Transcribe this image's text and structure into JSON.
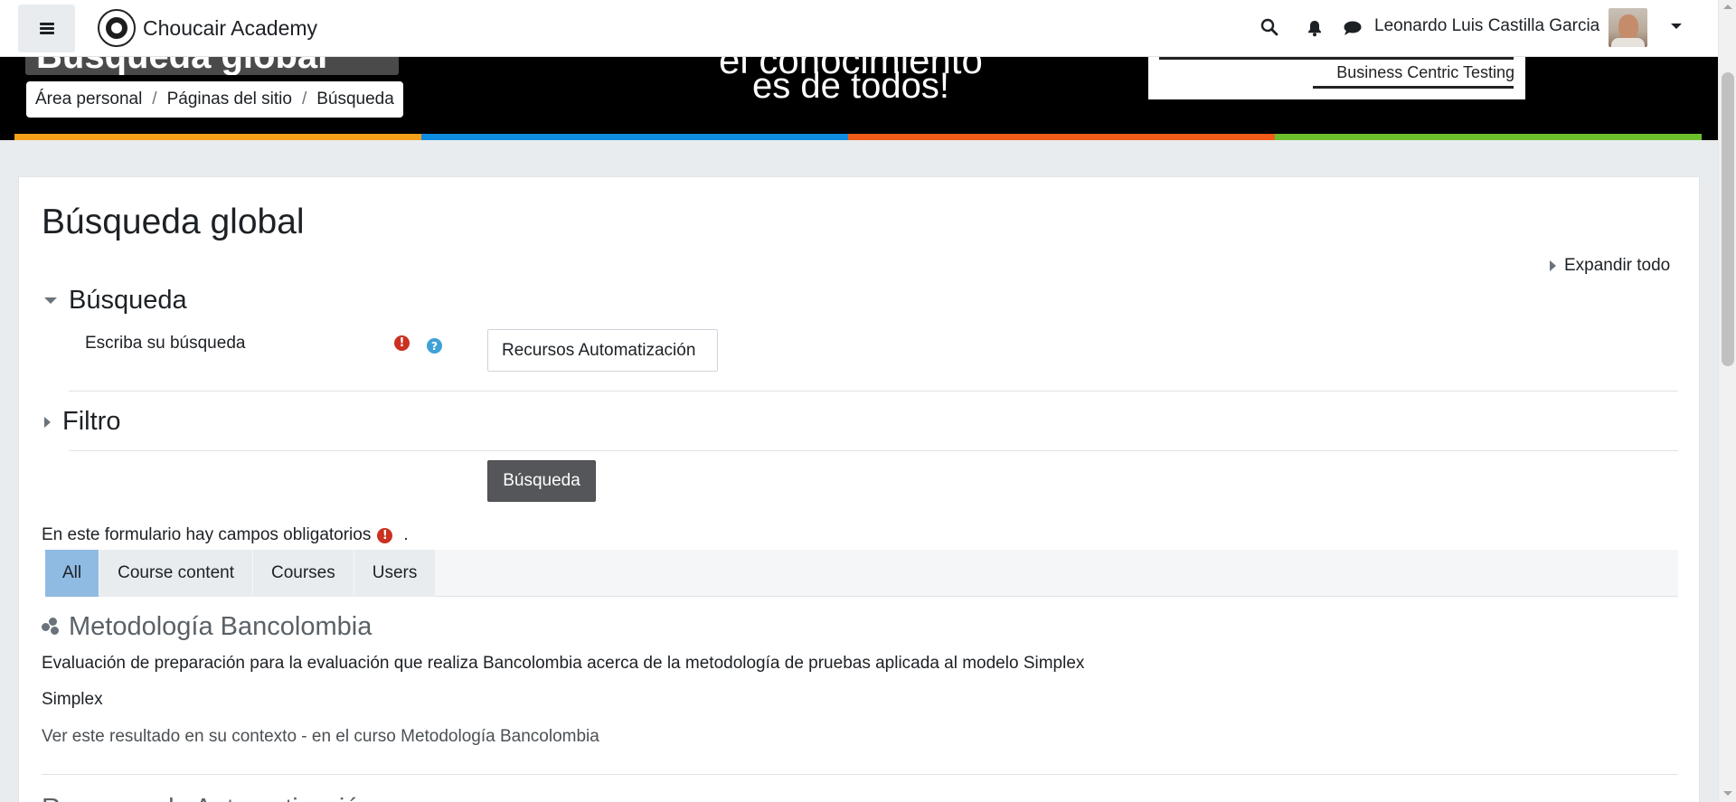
{
  "navbar": {
    "site_name": "Choucair Academy",
    "user_name": "Leonardo Luis Castilla Garcia",
    "icons": [
      "menu-icon",
      "search-icon",
      "bell-icon",
      "chat-icon",
      "chevron-down-icon"
    ]
  },
  "banner": {
    "title_partial": "Búsqueda global",
    "tagline_top": "el conocimiento",
    "tagline": "es de todos!",
    "partner_text": "Business Centric Testing",
    "stripe_colors": [
      "#f7a11a",
      "#0f8ce0",
      "#f15d19",
      "#6bbf2d"
    ]
  },
  "breadcrumb": [
    "Área personal",
    "Páginas del sitio",
    "Búsqueda"
  ],
  "page": {
    "title": "Búsqueda global",
    "expand_all": "Expandir todo"
  },
  "form": {
    "section_search": "Búsqueda",
    "field_label": "Escriba su búsqueda",
    "field_value": "Recursos Automatización",
    "section_filter": "Filtro",
    "submit_label": "Búsqueda",
    "required_note": "En este formulario hay campos obligatorios",
    "required_note_end": "."
  },
  "tabs": [
    {
      "label": "All",
      "active": true
    },
    {
      "label": "Course content",
      "active": false
    },
    {
      "label": "Courses",
      "active": false
    },
    {
      "label": "Users",
      "active": false
    }
  ],
  "results": [
    {
      "title": "Metodología Bancolombia",
      "description": "Evaluación de preparación para la evaluación que realiza Bancolombia acerca de la metodología de pruebas aplicada al modelo Simplex",
      "course": "Simplex",
      "context": "Ver este resultado en su contexto - en el curso Metodología Bancolombia"
    }
  ],
  "next_result_partial": "Recursos de Automatización",
  "colors": {
    "accent_active_tab": "#8fbbe3",
    "required": "#ca3120",
    "help": "#3fa1d6",
    "button": "#55565a"
  }
}
